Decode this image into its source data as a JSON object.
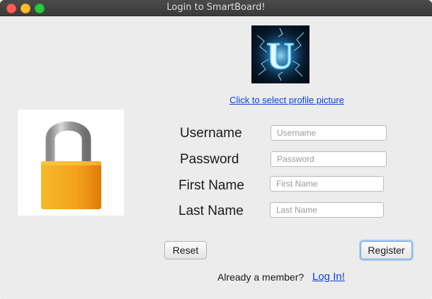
{
  "window": {
    "title": "Login to SmartBoard!",
    "controls": [
      "close",
      "minimize",
      "maximize"
    ]
  },
  "profile": {
    "picture_icon": "lightning-letter-u-icon",
    "picture_letter": "U",
    "select_link": "Click to select profile picture"
  },
  "lock_image": {
    "icon": "padlock-icon"
  },
  "form": {
    "username": {
      "label": "Username",
      "placeholder": "Username",
      "value": ""
    },
    "password": {
      "label": "Password",
      "placeholder": "Password",
      "value": ""
    },
    "first_name": {
      "label": "First Name",
      "placeholder": "First Name",
      "value": ""
    },
    "last_name": {
      "label": "Last Name",
      "placeholder": "Last Name",
      "value": ""
    }
  },
  "buttons": {
    "reset": "Reset",
    "register": "Register"
  },
  "footer": {
    "member_text": "Already a member?",
    "login_link": "Log In!"
  },
  "colors": {
    "link": "#0b3fdc",
    "window_bg": "#ececec",
    "titlebar": "#3d3d3d",
    "lock_body": "#f0a020",
    "register_focus": "#a9cdf2"
  }
}
